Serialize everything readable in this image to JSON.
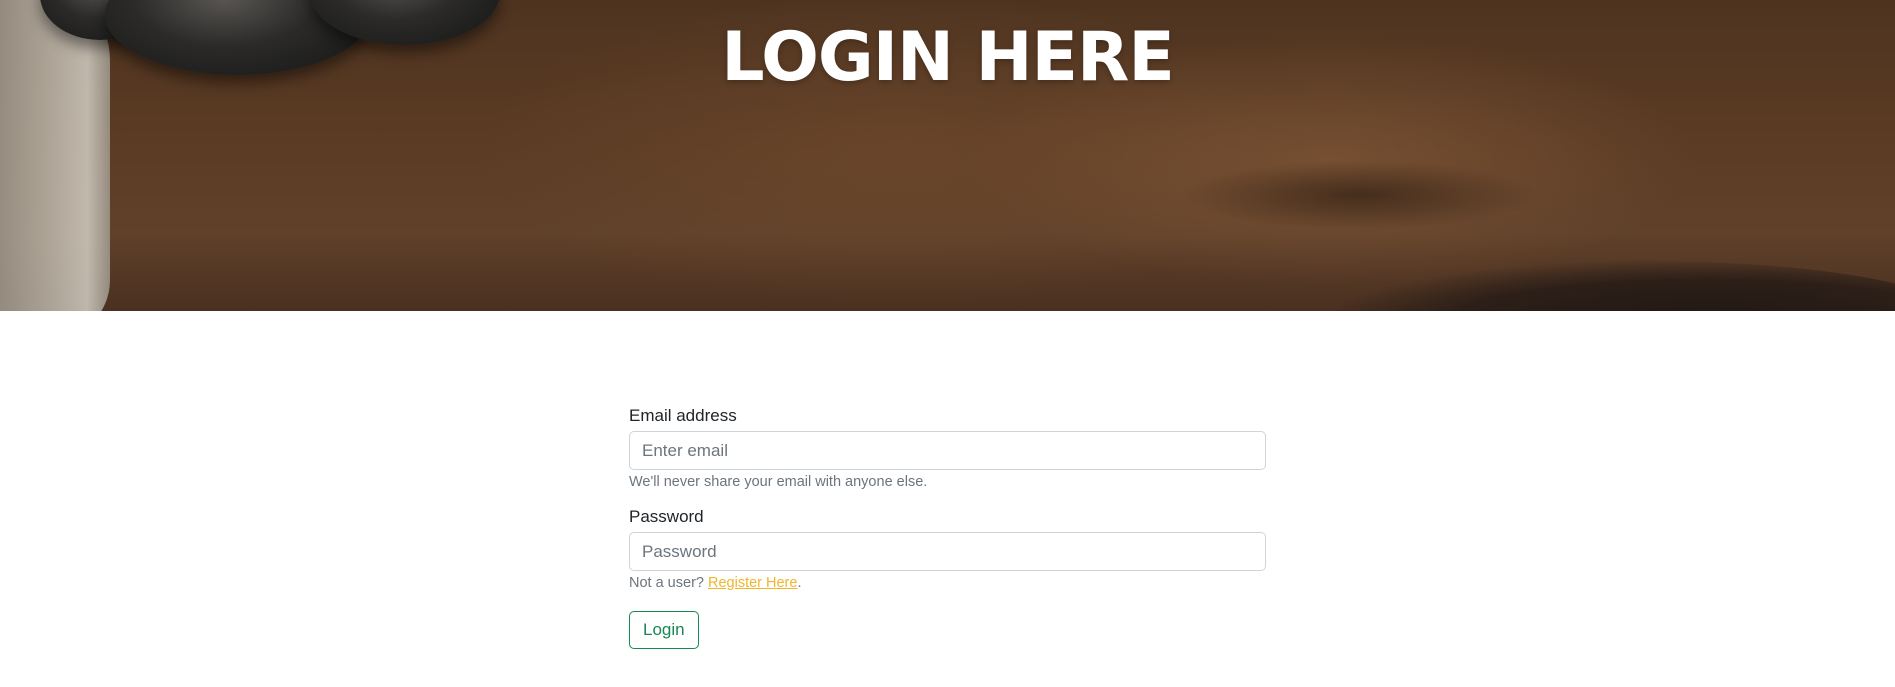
{
  "hero": {
    "title": "LOGIN HERE",
    "background_image": "spa-hot-stones-massage"
  },
  "form": {
    "email": {
      "label": "Email address",
      "placeholder": "Enter email",
      "value": "",
      "help": "We'll never share your email with anyone else."
    },
    "password": {
      "label": "Password",
      "placeholder": "Password",
      "value": ""
    },
    "register_prompt": {
      "prefix": "Not a user? ",
      "link_label": "Register Here",
      "suffix": "."
    },
    "submit_label": "Login"
  },
  "colors": {
    "accent_green": "#198754",
    "link_yellow": "#f0b52a",
    "muted_text": "#6c757d",
    "input_border": "#ced4da"
  }
}
